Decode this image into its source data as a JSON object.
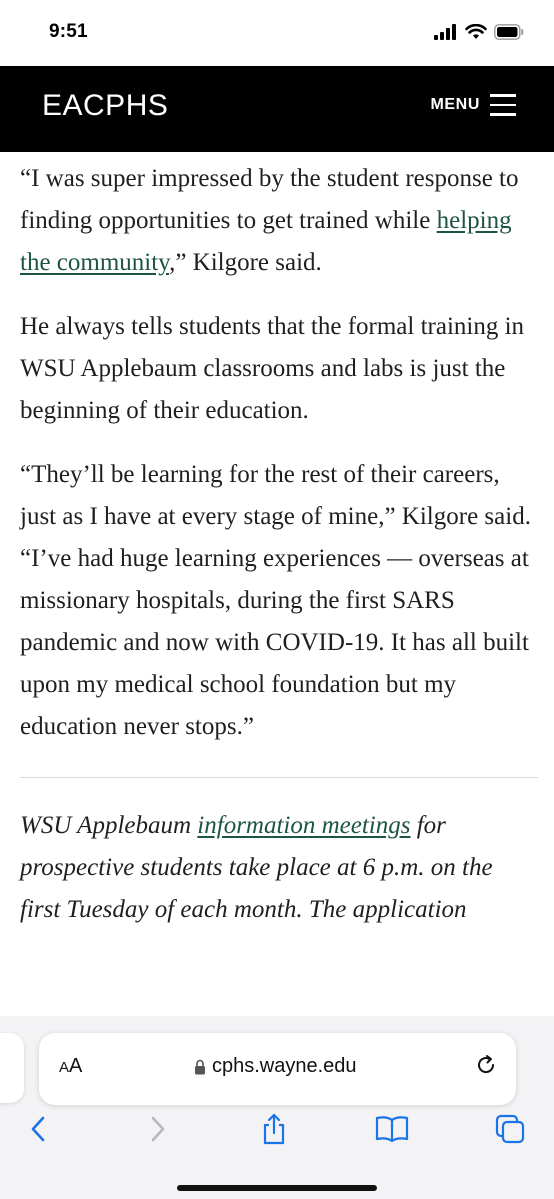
{
  "status_bar": {
    "time": "9:51",
    "icons": [
      "signal-icon",
      "wifi-icon",
      "battery-icon"
    ]
  },
  "header": {
    "site_title": "EACPHS",
    "menu_label": "MENU",
    "background_color": "#000000",
    "text_color": "#ffffff"
  },
  "article": {
    "p1": {
      "before_link": "“I was super impressed by the student response to finding opportunities to get trained while ",
      "link_text": "helping the community",
      "after_link": ",” Kilgore said."
    },
    "p2": "He always tells students that the formal training in WSU Applebaum classrooms and labs is just the beginning of their education.",
    "p3": "“They’ll be learning for the rest of their careers, just as I have at every stage of mine,” Kilgore said. “I’ve had huge learning experiences — overseas at missionary hospitals, during the first SARS pandemic and now with COVID-19. It has all built upon my medical school foundation but my education never stops.”",
    "note": {
      "before_link": "WSU Applebaum ",
      "link_text": "information meetings",
      "after_link": " for prospective students take place at 6 p.m. on the first Tuesday of each month. The application"
    },
    "link_color": "#1e5540"
  },
  "browser": {
    "aa_label_small": "A",
    "aa_label_large": "A",
    "url": "cphs.wayne.edu",
    "toolbar_icons": [
      "back-icon",
      "forward-icon",
      "share-icon",
      "bookmarks-icon",
      "tabs-icon"
    ],
    "accent_color": "#1a73e8"
  }
}
